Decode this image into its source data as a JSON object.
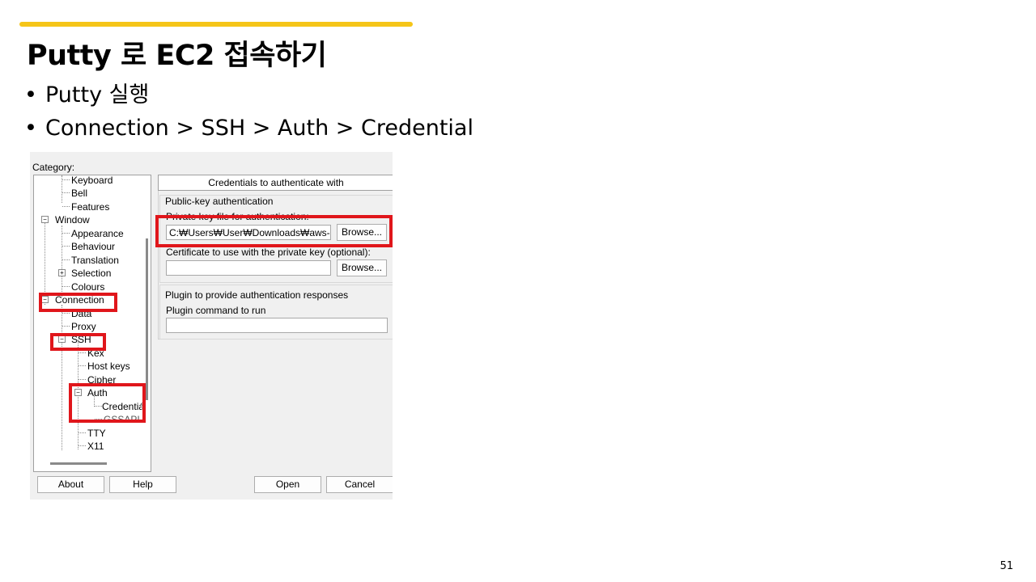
{
  "slide": {
    "title": "Putty 로 EC2 접속하기",
    "bullets": [
      "Putty 실행",
      "Connection > SSH > Auth > Credential"
    ],
    "page_number": "51",
    "accent_color": "#f5c518",
    "highlight_color": "#e0161b",
    "bullet_symbol": "•"
  },
  "putty": {
    "category_label": "Category:",
    "tree": {
      "keyboard": "Keyboard",
      "bell": "Bell",
      "features": "Features",
      "window": "Window",
      "appearance": "Appearance",
      "behaviour": "Behaviour",
      "translation": "Translation",
      "selection": "Selection",
      "colours": "Colours",
      "connection": "Connection",
      "data": "Data",
      "proxy": "Proxy",
      "ssh": "SSH",
      "kex": "Kex",
      "host_keys": "Host keys",
      "cipher": "Cipher",
      "auth": "Auth",
      "credentials": "Credentiá",
      "gssapi": "GSSAPI",
      "tty": "TTY",
      "x11": "X11"
    },
    "panel": {
      "header": "Credentials to authenticate with",
      "pubkey_group": "Public-key authentication",
      "private_key_label": "Private key file for authentication:",
      "private_key_value": "C:₩Users₩User₩Downloads₩aws-ag",
      "browse_label": "Browse...",
      "cert_label": "Certificate to use with the private key (optional):",
      "cert_value": "",
      "browse2_label": "Browse...",
      "plugin_group": "Plugin to provide authentication responses",
      "plugin_cmd_label": "Plugin command to run",
      "plugin_cmd_value": ""
    },
    "buttons": {
      "about": "About",
      "help": "Help",
      "open": "Open",
      "cancel": "Cancel"
    }
  }
}
